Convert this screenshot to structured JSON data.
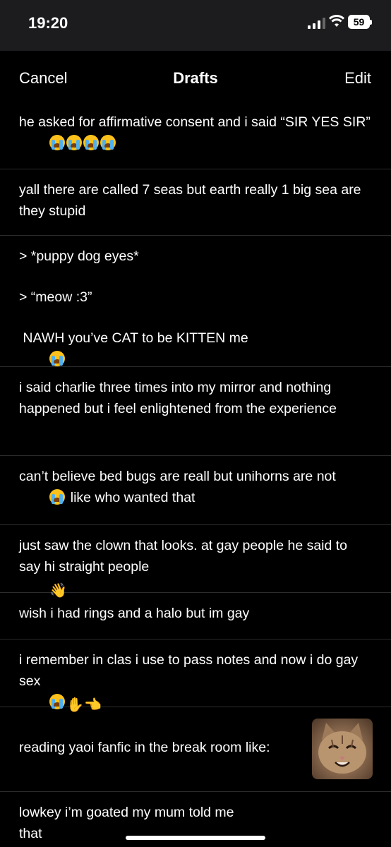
{
  "status": {
    "time": "19:20",
    "battery": "59"
  },
  "nav": {
    "cancel": "Cancel",
    "title": "Drafts",
    "edit": "Edit"
  },
  "drafts": [
    {
      "text": "he asked for affirmative consent and i said “SIR YES SIR”"
    },
    {
      "text": "yall there are called 7 seas but earth really 1 big sea are they stupid"
    },
    {
      "line1": "> *puppy dog eyes*",
      "line2": "> “meow :3”",
      "line3": " NAWH you’ve CAT to be KITTEN me"
    },
    {
      "text": "i said charlie three times into my mirror and nothing happened but i feel enlightened from the experience"
    },
    {
      "text_a": "can’t believe bed bugs are reall but unihorns are not",
      "text_b": " like who wanted that"
    },
    {
      "text": "just saw the clown that looks. at gay people he said to say hi straight people"
    },
    {
      "text": "wish i had rings and a halo but im gay"
    },
    {
      "text": "i remember in clas i use to pass notes and now i do gay sex"
    },
    {
      "text": "reading yaoi fanfic in the break room like:"
    },
    {
      "text": "lowkey i’m goated my mum told me that"
    }
  ],
  "icons": {
    "emoji_crying": "loudly-crying-face",
    "emoji_wave": "waving-hand",
    "emoji_raised": "raised-hand",
    "emoji_point": "backhand-index-pointing-left",
    "attachment": "smiling-cat-photo"
  }
}
